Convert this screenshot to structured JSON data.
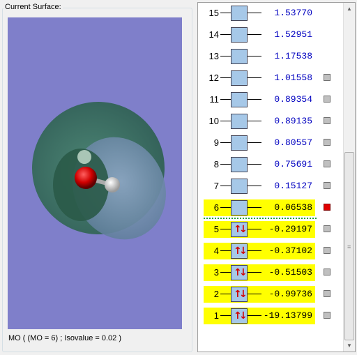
{
  "surface_panel": {
    "title": "Current Surface:",
    "status": "MO ( (MO = 6) ; Isovalue = 0.02 )"
  },
  "orbitals": [
    {
      "n": "15",
      "energy": "1.53770",
      "occupied": false,
      "highlight": false,
      "selectable": false,
      "selected": false
    },
    {
      "n": "14",
      "energy": "1.52951",
      "occupied": false,
      "highlight": false,
      "selectable": false,
      "selected": false
    },
    {
      "n": "13",
      "energy": "1.17538",
      "occupied": false,
      "highlight": false,
      "selectable": false,
      "selected": false
    },
    {
      "n": "12",
      "energy": "1.01558",
      "occupied": false,
      "highlight": false,
      "selectable": true,
      "selected": false
    },
    {
      "n": "11",
      "energy": "0.89354",
      "occupied": false,
      "highlight": false,
      "selectable": true,
      "selected": false
    },
    {
      "n": "10",
      "energy": "0.89135",
      "occupied": false,
      "highlight": false,
      "selectable": true,
      "selected": false
    },
    {
      "n": "9",
      "energy": "0.80557",
      "occupied": false,
      "highlight": false,
      "selectable": true,
      "selected": false
    },
    {
      "n": "8",
      "energy": "0.75691",
      "occupied": false,
      "highlight": false,
      "selectable": true,
      "selected": false
    },
    {
      "n": "7",
      "energy": "0.15127",
      "occupied": false,
      "highlight": false,
      "selectable": true,
      "selected": false
    },
    {
      "n": "6",
      "energy": "0.06538",
      "occupied": false,
      "highlight": true,
      "selectable": true,
      "selected": true
    },
    {
      "n": "5",
      "energy": "-0.29197",
      "occupied": true,
      "highlight": true,
      "selectable": true,
      "selected": false
    },
    {
      "n": "4",
      "energy": "-0.37102",
      "occupied": true,
      "highlight": true,
      "selectable": true,
      "selected": false
    },
    {
      "n": "3",
      "energy": "-0.51503",
      "occupied": true,
      "highlight": true,
      "selectable": true,
      "selected": false
    },
    {
      "n": "2",
      "energy": "-0.99736",
      "occupied": true,
      "highlight": true,
      "selectable": true,
      "selected": false
    },
    {
      "n": "1",
      "energy": "-19.13799",
      "occupied": true,
      "highlight": true,
      "selectable": true,
      "selected": false
    }
  ],
  "spin_glyphs": {
    "up": "↑",
    "down": "↓"
  },
  "colors": {
    "viewport_bg": "#7f7fca",
    "highlight": "#ffff00",
    "orbital_box": "#a6c8e8",
    "virtual_energy": "#0000c0",
    "selected_marker": "#e00000",
    "isosurface": "#3f7a66"
  },
  "icons": {
    "scroll_up": "up-arrow-icon",
    "scroll_down": "down-arrow-icon"
  },
  "scrollbar_glyphs": {
    "up": "▲",
    "down": "▼",
    "grip": "≡"
  }
}
